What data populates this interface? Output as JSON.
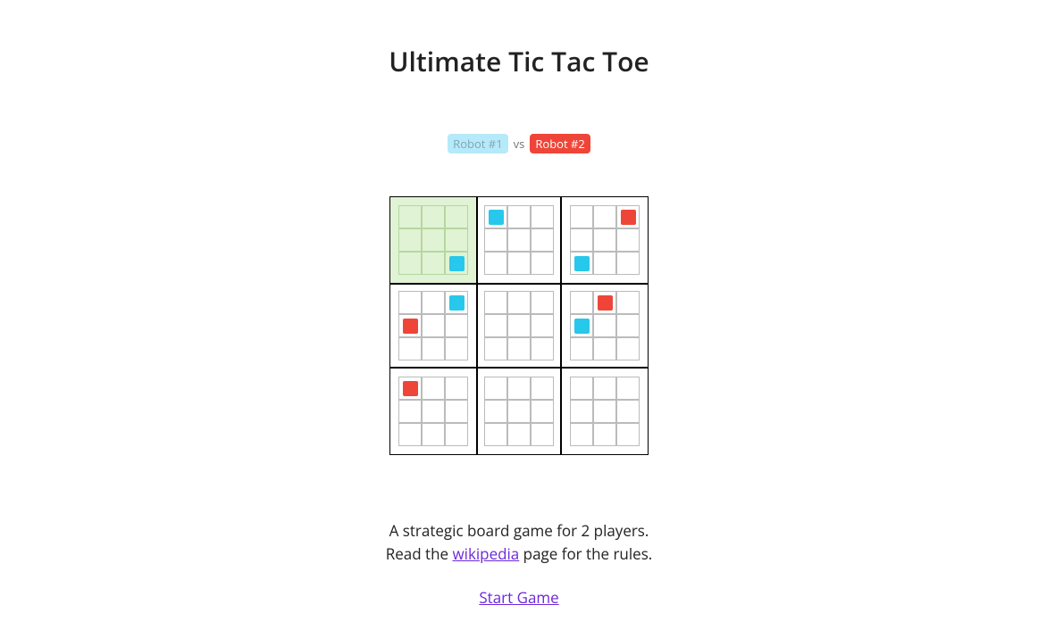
{
  "title": "Ultimate Tic Tac Toe",
  "players": {
    "p1_label": "Robot #1",
    "vs": "vs",
    "p2_label": "Robot #2",
    "p1_color": "#27c8eb",
    "p2_color": "#ef4538"
  },
  "board": {
    "highlight_big_cell": 0,
    "big_cells": [
      {
        "cells": [
          null,
          null,
          null,
          null,
          null,
          null,
          null,
          null,
          "p1"
        ]
      },
      {
        "cells": [
          "p1",
          null,
          null,
          null,
          null,
          null,
          null,
          null,
          null
        ]
      },
      {
        "cells": [
          null,
          null,
          "p2",
          null,
          null,
          null,
          "p1",
          null,
          null
        ]
      },
      {
        "cells": [
          null,
          null,
          "p1",
          "p2",
          null,
          null,
          null,
          null,
          null
        ]
      },
      {
        "cells": [
          null,
          null,
          null,
          null,
          null,
          null,
          null,
          null,
          null
        ]
      },
      {
        "cells": [
          null,
          "p2",
          null,
          "p1",
          null,
          null,
          null,
          null,
          null
        ]
      },
      {
        "cells": [
          "p2",
          null,
          null,
          null,
          null,
          null,
          null,
          null,
          null
        ]
      },
      {
        "cells": [
          null,
          null,
          null,
          null,
          null,
          null,
          null,
          null,
          null
        ]
      },
      {
        "cells": [
          null,
          null,
          null,
          null,
          null,
          null,
          null,
          null,
          null
        ]
      }
    ]
  },
  "footer": {
    "line1": "A strategic board game for 2 players.",
    "line2a": "Read the ",
    "wiki_text": "wikipedia",
    "line2b": " page for the rules.",
    "start_text": "Start Game"
  }
}
